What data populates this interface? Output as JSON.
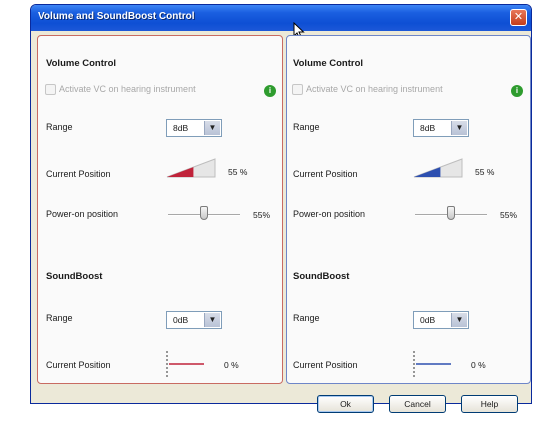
{
  "window": {
    "title": "Volume and SoundBoost Control",
    "close_icon": "close-icon"
  },
  "left_panel": {
    "accent_color": "#c0233a",
    "volume": {
      "heading": "Volume Control",
      "checkbox_label": "Activate VC on hearing instrument",
      "checked": false,
      "info_icon": "info-icon",
      "range_label": "Range",
      "range_value": "8dB",
      "current_position_label": "Current Position",
      "current_position_value": "55 %",
      "current_position_fraction": 0.55,
      "power_on_label": "Power-on position",
      "power_on_value": "55%",
      "power_on_fraction": 0.55
    },
    "soundboost": {
      "heading": "SoundBoost",
      "range_label": "Range",
      "range_value": "0dB",
      "current_position_label": "Current Position",
      "current_position_value": "0 %",
      "current_position_fraction": 0
    }
  },
  "right_panel": {
    "accent_color": "#2d4fb0",
    "volume": {
      "heading": "Volume Control",
      "checkbox_label": "Activate VC on hearing instrument",
      "checked": false,
      "info_icon": "info-icon",
      "range_label": "Range",
      "range_value": "8dB",
      "current_position_label": "Current Position",
      "current_position_value": "55 %",
      "current_position_fraction": 0.55,
      "power_on_label": "Power-on position",
      "power_on_value": "55%",
      "power_on_fraction": 0.55
    },
    "soundboost": {
      "heading": "SoundBoost",
      "range_label": "Range",
      "range_value": "0dB",
      "current_position_label": "Current Position",
      "current_position_value": "0 %",
      "current_position_fraction": 0
    }
  },
  "buttons": {
    "ok": "Ok",
    "cancel": "Cancel",
    "help": "Help"
  }
}
